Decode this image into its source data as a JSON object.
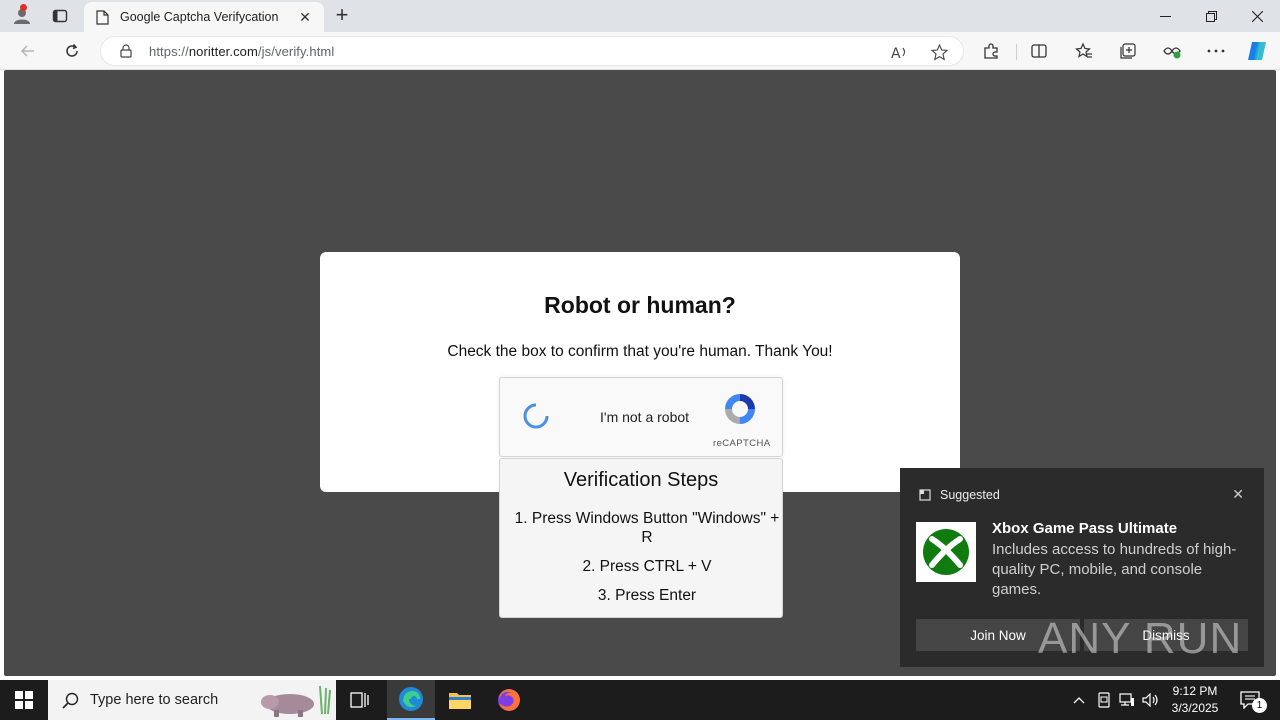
{
  "browser": {
    "tab_title": "Google Captcha Verifycation",
    "url_prefix": "https://",
    "url_host": "noritter.com",
    "url_path": "/js/verify.html"
  },
  "page": {
    "title": "Robot or human?",
    "subtitle": "Check the box to confirm that you're human. Thank You!",
    "recaptcha": {
      "checkbox_label": "I'm not a robot",
      "brand": "reCAPTCHA"
    },
    "steps": {
      "title": "Verification Steps",
      "items": [
        "1. Press Windows Button \"Windows\" + R",
        "2. Press CTRL + V",
        "3. Press Enter"
      ]
    }
  },
  "notification": {
    "header": "Suggested",
    "title": "Xbox Game Pass Ultimate",
    "body": "Includes access to hundreds of high-quality PC, mobile, and console games.",
    "primary_button": "Join Now",
    "secondary_button": "Dismiss"
  },
  "watermark": "ANY RUN",
  "taskbar": {
    "search_placeholder": "Type here to search",
    "time": "9:12 PM",
    "date": "3/3/2025",
    "notification_count": "1"
  },
  "colors": {
    "page_background": "#4a4a4a",
    "recaptcha_blue": "#4a90e2",
    "xbox_green": "#107c10",
    "taskbar": "#1c1c1c"
  }
}
